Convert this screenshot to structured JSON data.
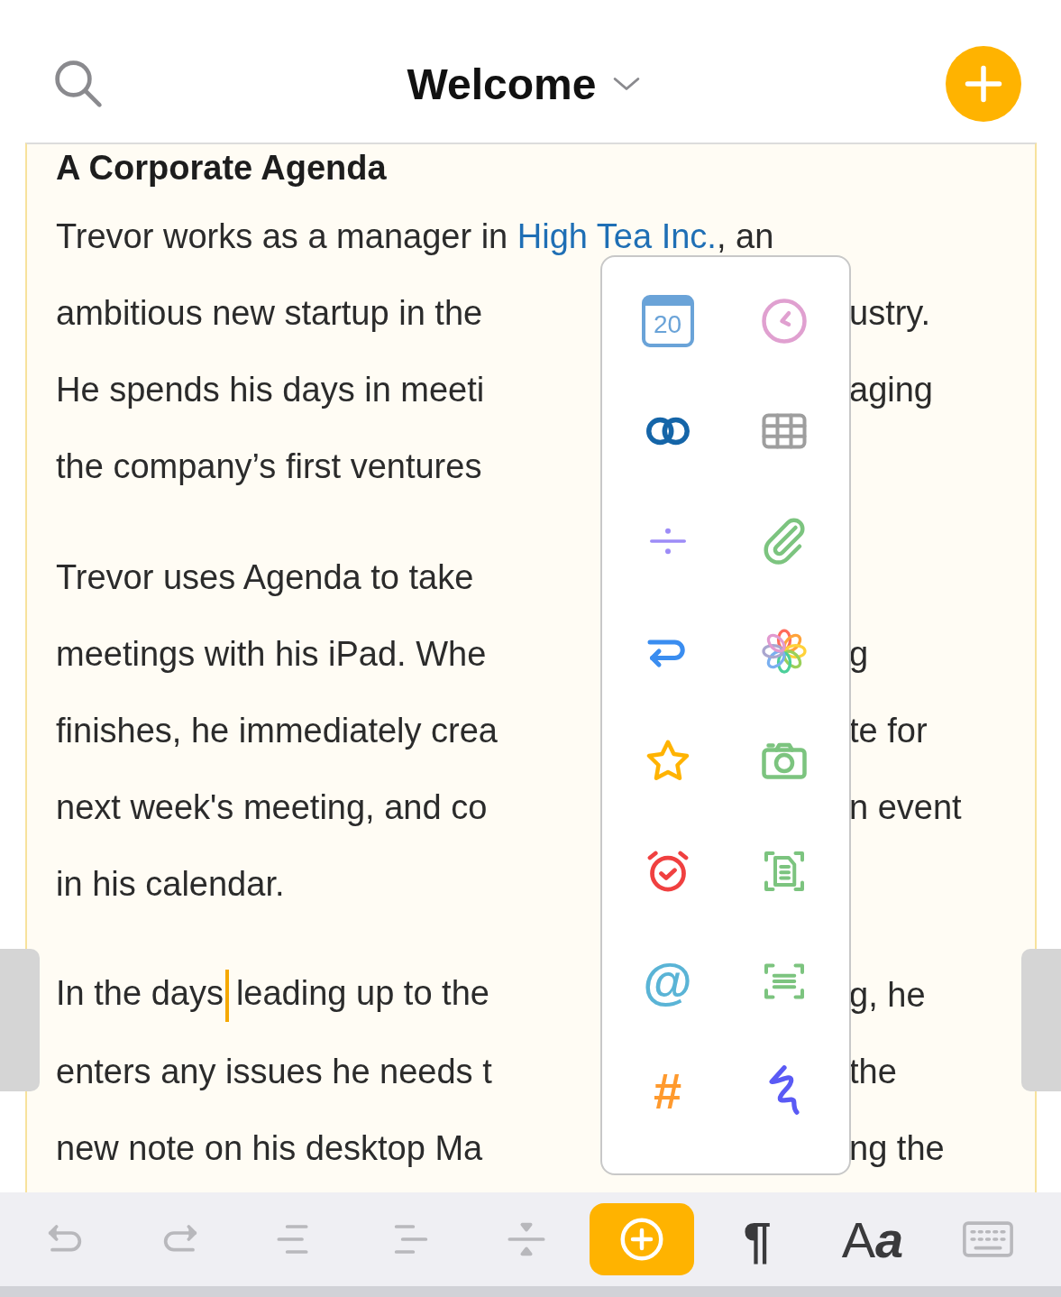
{
  "header": {
    "title": "Welcome"
  },
  "note": {
    "heading": "A Corporate Agenda",
    "paragraphs": [
      {
        "lines": [
          {
            "left": [
              {
                "kind": "text",
                "text": "Trevor works as a manager in "
              },
              {
                "kind": "link",
                "text": "High Tea Inc."
              },
              {
                "kind": "text",
                "text": ", an"
              }
            ]
          },
          {
            "left": [
              {
                "kind": "text",
                "text": "ambitious new startup in the"
              }
            ],
            "right": "ustry."
          },
          {
            "left": [
              {
                "kind": "text",
                "text": "He spends his days in meeti"
              }
            ],
            "right": "aging"
          },
          {
            "left": [
              {
                "kind": "text",
                "text": "the company’s first ventures"
              }
            ]
          }
        ]
      },
      {
        "lines": [
          {
            "left": [
              {
                "kind": "text",
                "text": "Trevor uses Agenda to take"
              }
            ]
          },
          {
            "left": [
              {
                "kind": "text",
                "text": "meetings with his iPad. Whe"
              }
            ],
            "right": "g"
          },
          {
            "left": [
              {
                "kind": "text",
                "text": "finishes, he immediately crea"
              }
            ],
            "right": "te for"
          },
          {
            "left": [
              {
                "kind": "text",
                "text": "next week's meeting, and co"
              }
            ],
            "right": "n event"
          },
          {
            "left": [
              {
                "kind": "text",
                "text": "in his calendar."
              }
            ]
          }
        ]
      },
      {
        "lines": [
          {
            "left": [
              {
                "kind": "text",
                "text": "In the days"
              },
              {
                "kind": "cursor"
              },
              {
                "kind": "text",
                "text": "leading up to the"
              }
            ],
            "right": "g, he"
          },
          {
            "left": [
              {
                "kind": "text",
                "text": "enters any issues he needs t"
              }
            ],
            "right": "the"
          },
          {
            "left": [
              {
                "kind": "text",
                "text": "new note on his desktop Ma"
              }
            ],
            "right": "ng the"
          }
        ]
      }
    ]
  },
  "insert_menu": [
    {
      "kind": "calendar",
      "label": "20"
    },
    {
      "kind": "clock"
    },
    {
      "kind": "link"
    },
    {
      "kind": "table"
    },
    {
      "kind": "divider"
    },
    {
      "kind": "attachment"
    },
    {
      "kind": "return"
    },
    {
      "kind": "photos"
    },
    {
      "kind": "star"
    },
    {
      "kind": "camera"
    },
    {
      "kind": "alarm"
    },
    {
      "kind": "scan-document"
    },
    {
      "kind": "mention",
      "label": "@"
    },
    {
      "kind": "scan-text"
    },
    {
      "kind": "tag",
      "label": "#"
    },
    {
      "kind": "sketch"
    }
  ],
  "toolbar": [
    {
      "kind": "undo",
      "disabled": true,
      "selected": false
    },
    {
      "kind": "redo",
      "disabled": true,
      "selected": false
    },
    {
      "kind": "outdent",
      "disabled": true,
      "selected": false
    },
    {
      "kind": "indent",
      "disabled": true,
      "selected": false
    },
    {
      "kind": "collapse",
      "disabled": true,
      "selected": false
    },
    {
      "kind": "insert",
      "disabled": false,
      "selected": true
    },
    {
      "kind": "text",
      "label": "¶",
      "disabled": false,
      "selected": false
    },
    {
      "kind": "font",
      "label": "A",
      "label_2": "a",
      "disabled": false,
      "selected": false
    },
    {
      "kind": "keyboard",
      "disabled": true,
      "selected": false
    }
  ]
}
